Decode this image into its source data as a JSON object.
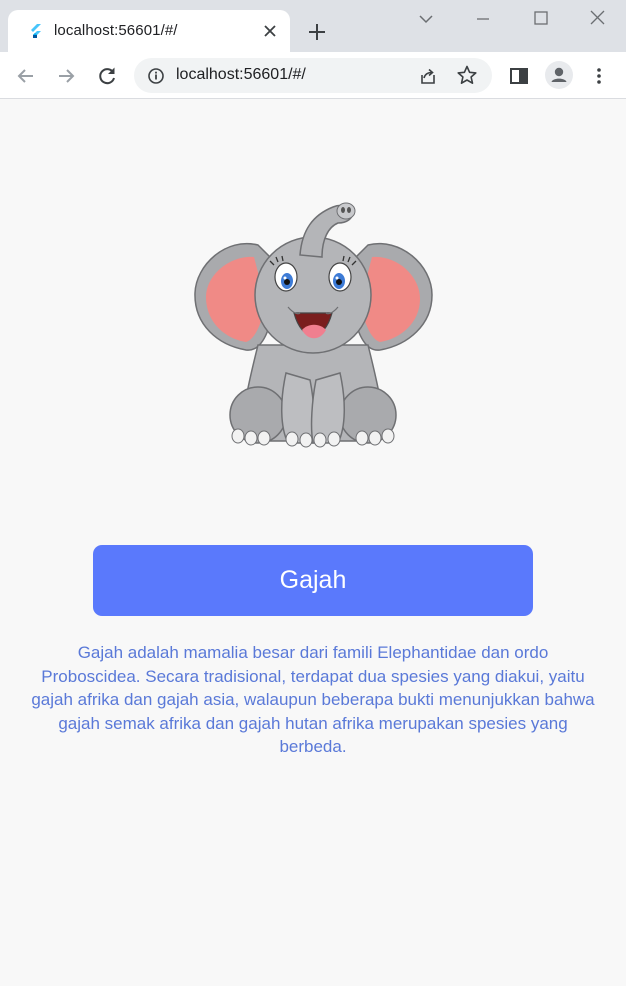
{
  "browser": {
    "tab_title": "localhost:56601/#/",
    "url": "localhost:56601/#/"
  },
  "page": {
    "button_label": "Gajah",
    "description": "Gajah adalah mamalia besar dari famili Elephantidae dan ordo Proboscidea. Secara tradisional, terdapat dua spesies yang diakui, yaitu gajah afrika dan gajah asia, walaupun beberapa bukti menunjukkan bahwa gajah semak afrika dan gajah hutan afrika merupakan spesies yang berbeda."
  },
  "colors": {
    "button": "#5a79fc",
    "description_text": "#5a79d8",
    "background": "#f8f8f8"
  }
}
